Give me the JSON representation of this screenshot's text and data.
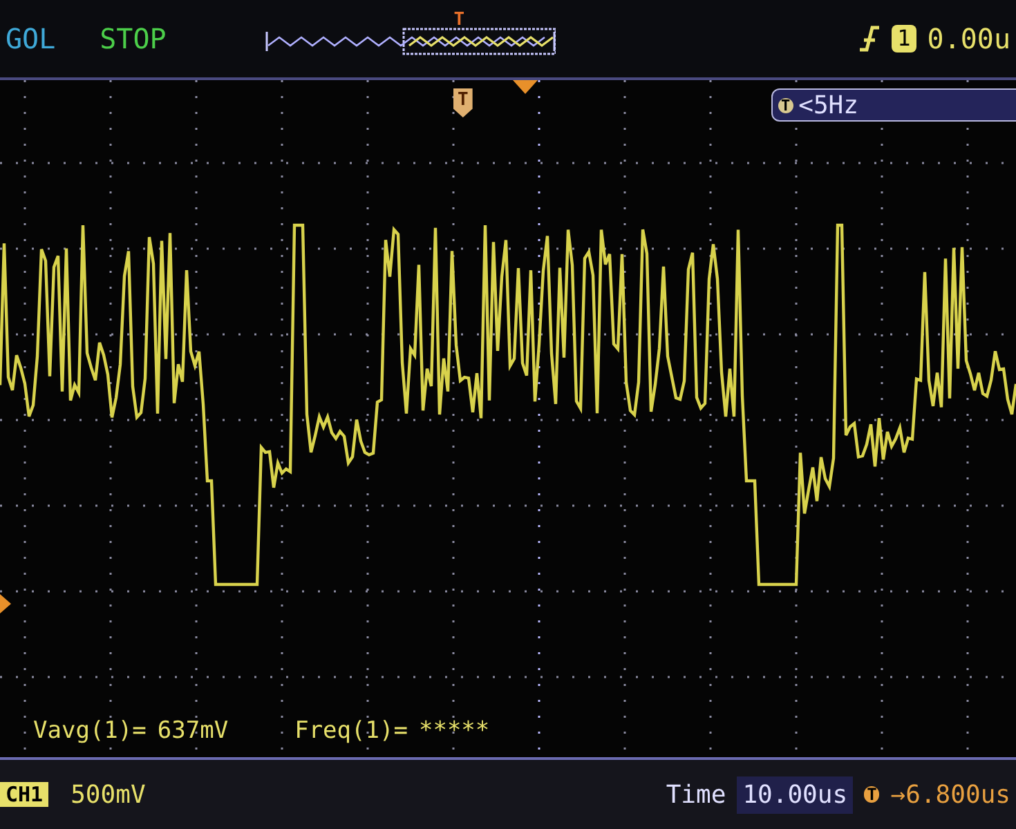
{
  "header": {
    "trigger_mode": "GOL",
    "run_state": "STOP",
    "memory_marker": "T",
    "channel_badge": "1",
    "trigger_level": "0.00u"
  },
  "plot": {
    "trigger_marker": "T",
    "freq_icon": "T",
    "trigger_freq": "<5Hz",
    "measurements": [
      {
        "label": "Vavg(1)=",
        "value": "637mV"
      },
      {
        "label": "Freq(1)=",
        "value": "*****"
      }
    ]
  },
  "footer": {
    "channel": "CH1",
    "scale": "500mV",
    "time_label": "Time",
    "timebase": "10.00us",
    "offset_icon": "T",
    "offset": "→6.800us"
  }
}
